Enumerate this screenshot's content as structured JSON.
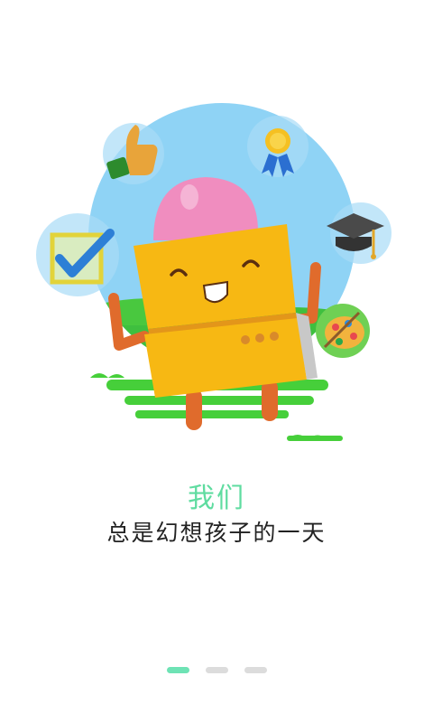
{
  "onboarding": {
    "heading": "我们",
    "subheading": "总是幻想孩子的一天"
  },
  "pager": {
    "page_count": 3,
    "active_index": 0
  },
  "colors": {
    "heading": "#5fdca0",
    "subheading": "#222222",
    "dot_active": "#6ee3b5",
    "dot_inactive": "#dcdcdc",
    "sky": "#8fd3f5",
    "grass": "#3fbf3f",
    "robot_body": "#f7b813",
    "robot_head": "#f08dbf"
  },
  "illustration": {
    "badges": [
      "thumbs-up-icon",
      "medal-icon",
      "checkbox-icon",
      "graduation-cap-icon",
      "palette-icon"
    ]
  }
}
